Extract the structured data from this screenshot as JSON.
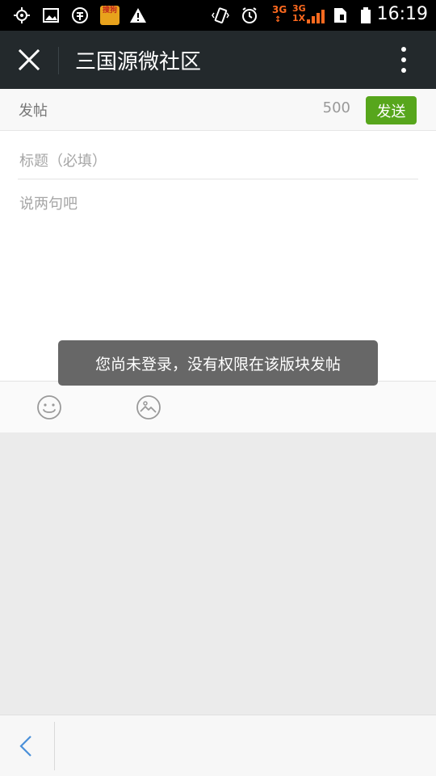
{
  "status_bar": {
    "time": "16:19",
    "network_1": "3G",
    "network_2_top": "3G",
    "network_2_bottom": "1X",
    "app_badge": "搜狗",
    "icons": [
      "gps-icon",
      "image-icon",
      "app-icon",
      "sogou-app-icon",
      "warning-icon",
      "vibrate-icon",
      "alarm-icon",
      "signal-icon",
      "sim-icon",
      "battery-icon"
    ]
  },
  "title_bar": {
    "title": "三国源微社区"
  },
  "post": {
    "header_label": "发帖",
    "char_limit": "500",
    "send_label": "发送",
    "title_placeholder": "标题（必填）",
    "body_placeholder": "说两句吧"
  },
  "toast": {
    "message": "您尚未登录，没有权限在该版块发帖"
  },
  "colors": {
    "title_bar_bg": "#23292c",
    "send_button": "#57a61c",
    "page_bg": "#ebebeb"
  }
}
